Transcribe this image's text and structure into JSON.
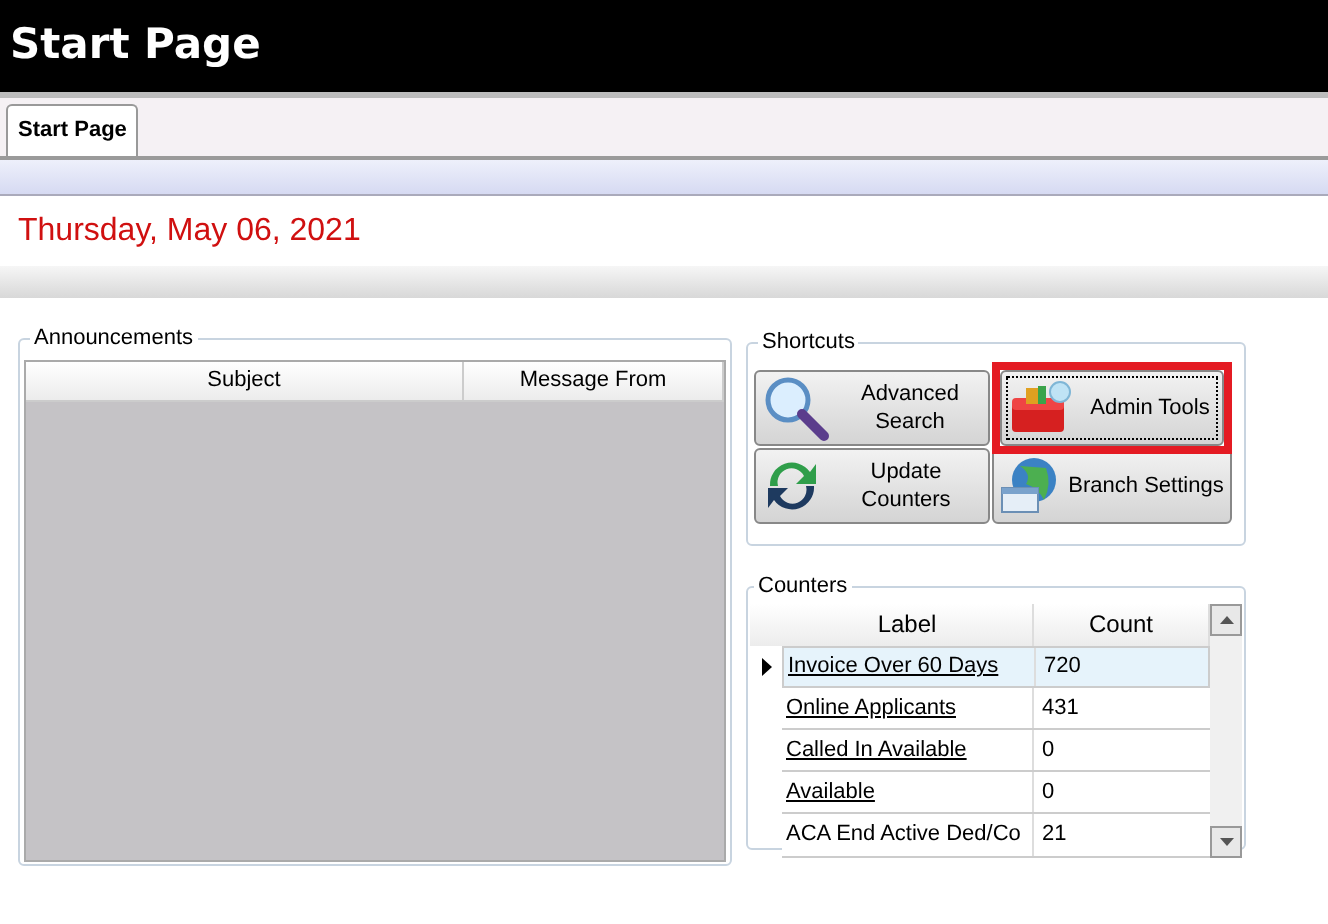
{
  "window": {
    "title": "Start Page"
  },
  "tabs": [
    {
      "label": "Start Page",
      "selected": true
    }
  ],
  "date": "Thursday, May 06, 2021",
  "announcements": {
    "title": "Announcements",
    "columns": [
      "Subject",
      "Message From"
    ]
  },
  "shortcuts": {
    "title": "Shortcuts",
    "buttons": [
      {
        "label": "Advanced Search",
        "kind": "search",
        "highlighted": false
      },
      {
        "label": "Admin Tools",
        "kind": "toolbox",
        "highlighted": true
      },
      {
        "label": "Update Counters",
        "kind": "refresh",
        "highlighted": false
      },
      {
        "label": "Branch Settings",
        "kind": "globe",
        "highlighted": false
      }
    ]
  },
  "counters": {
    "title": "Counters",
    "columns": [
      "Label",
      "Count"
    ],
    "rows": [
      {
        "label": "Invoice Over 60 Days",
        "count": "720",
        "selected": true,
        "link": true
      },
      {
        "label": "Online Applicants",
        "count": "431",
        "selected": false,
        "link": true
      },
      {
        "label": "Called In Available",
        "count": "0",
        "selected": false,
        "link": true
      },
      {
        "label": "Available",
        "count": "0",
        "selected": false,
        "link": true
      },
      {
        "label": "ACA End Active Ded/Co",
        "count": "21",
        "selected": false,
        "link": false
      }
    ]
  }
}
